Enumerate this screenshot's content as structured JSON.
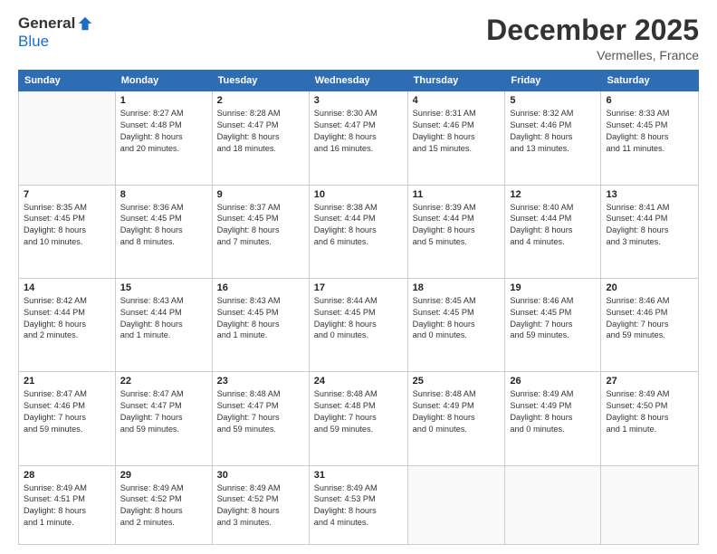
{
  "header": {
    "logo_general": "General",
    "logo_blue": "Blue",
    "month_title": "December 2025",
    "location": "Vermelles, France"
  },
  "days_of_week": [
    "Sunday",
    "Monday",
    "Tuesday",
    "Wednesday",
    "Thursday",
    "Friday",
    "Saturday"
  ],
  "weeks": [
    [
      {
        "day": "",
        "info": ""
      },
      {
        "day": "1",
        "info": "Sunrise: 8:27 AM\nSunset: 4:48 PM\nDaylight: 8 hours\nand 20 minutes."
      },
      {
        "day": "2",
        "info": "Sunrise: 8:28 AM\nSunset: 4:47 PM\nDaylight: 8 hours\nand 18 minutes."
      },
      {
        "day": "3",
        "info": "Sunrise: 8:30 AM\nSunset: 4:47 PM\nDaylight: 8 hours\nand 16 minutes."
      },
      {
        "day": "4",
        "info": "Sunrise: 8:31 AM\nSunset: 4:46 PM\nDaylight: 8 hours\nand 15 minutes."
      },
      {
        "day": "5",
        "info": "Sunrise: 8:32 AM\nSunset: 4:46 PM\nDaylight: 8 hours\nand 13 minutes."
      },
      {
        "day": "6",
        "info": "Sunrise: 8:33 AM\nSunset: 4:45 PM\nDaylight: 8 hours\nand 11 minutes."
      }
    ],
    [
      {
        "day": "7",
        "info": "Sunrise: 8:35 AM\nSunset: 4:45 PM\nDaylight: 8 hours\nand 10 minutes."
      },
      {
        "day": "8",
        "info": "Sunrise: 8:36 AM\nSunset: 4:45 PM\nDaylight: 8 hours\nand 8 minutes."
      },
      {
        "day": "9",
        "info": "Sunrise: 8:37 AM\nSunset: 4:45 PM\nDaylight: 8 hours\nand 7 minutes."
      },
      {
        "day": "10",
        "info": "Sunrise: 8:38 AM\nSunset: 4:44 PM\nDaylight: 8 hours\nand 6 minutes."
      },
      {
        "day": "11",
        "info": "Sunrise: 8:39 AM\nSunset: 4:44 PM\nDaylight: 8 hours\nand 5 minutes."
      },
      {
        "day": "12",
        "info": "Sunrise: 8:40 AM\nSunset: 4:44 PM\nDaylight: 8 hours\nand 4 minutes."
      },
      {
        "day": "13",
        "info": "Sunrise: 8:41 AM\nSunset: 4:44 PM\nDaylight: 8 hours\nand 3 minutes."
      }
    ],
    [
      {
        "day": "14",
        "info": "Sunrise: 8:42 AM\nSunset: 4:44 PM\nDaylight: 8 hours\nand 2 minutes."
      },
      {
        "day": "15",
        "info": "Sunrise: 8:43 AM\nSunset: 4:44 PM\nDaylight: 8 hours\nand 1 minute."
      },
      {
        "day": "16",
        "info": "Sunrise: 8:43 AM\nSunset: 4:45 PM\nDaylight: 8 hours\nand 1 minute."
      },
      {
        "day": "17",
        "info": "Sunrise: 8:44 AM\nSunset: 4:45 PM\nDaylight: 8 hours\nand 0 minutes."
      },
      {
        "day": "18",
        "info": "Sunrise: 8:45 AM\nSunset: 4:45 PM\nDaylight: 8 hours\nand 0 minutes."
      },
      {
        "day": "19",
        "info": "Sunrise: 8:46 AM\nSunset: 4:45 PM\nDaylight: 7 hours\nand 59 minutes."
      },
      {
        "day": "20",
        "info": "Sunrise: 8:46 AM\nSunset: 4:46 PM\nDaylight: 7 hours\nand 59 minutes."
      }
    ],
    [
      {
        "day": "21",
        "info": "Sunrise: 8:47 AM\nSunset: 4:46 PM\nDaylight: 7 hours\nand 59 minutes."
      },
      {
        "day": "22",
        "info": "Sunrise: 8:47 AM\nSunset: 4:47 PM\nDaylight: 7 hours\nand 59 minutes."
      },
      {
        "day": "23",
        "info": "Sunrise: 8:48 AM\nSunset: 4:47 PM\nDaylight: 7 hours\nand 59 minutes."
      },
      {
        "day": "24",
        "info": "Sunrise: 8:48 AM\nSunset: 4:48 PM\nDaylight: 7 hours\nand 59 minutes."
      },
      {
        "day": "25",
        "info": "Sunrise: 8:48 AM\nSunset: 4:49 PM\nDaylight: 8 hours\nand 0 minutes."
      },
      {
        "day": "26",
        "info": "Sunrise: 8:49 AM\nSunset: 4:49 PM\nDaylight: 8 hours\nand 0 minutes."
      },
      {
        "day": "27",
        "info": "Sunrise: 8:49 AM\nSunset: 4:50 PM\nDaylight: 8 hours\nand 1 minute."
      }
    ],
    [
      {
        "day": "28",
        "info": "Sunrise: 8:49 AM\nSunset: 4:51 PM\nDaylight: 8 hours\nand 1 minute."
      },
      {
        "day": "29",
        "info": "Sunrise: 8:49 AM\nSunset: 4:52 PM\nDaylight: 8 hours\nand 2 minutes."
      },
      {
        "day": "30",
        "info": "Sunrise: 8:49 AM\nSunset: 4:52 PM\nDaylight: 8 hours\nand 3 minutes."
      },
      {
        "day": "31",
        "info": "Sunrise: 8:49 AM\nSunset: 4:53 PM\nDaylight: 8 hours\nand 4 minutes."
      },
      {
        "day": "",
        "info": ""
      },
      {
        "day": "",
        "info": ""
      },
      {
        "day": "",
        "info": ""
      }
    ]
  ]
}
